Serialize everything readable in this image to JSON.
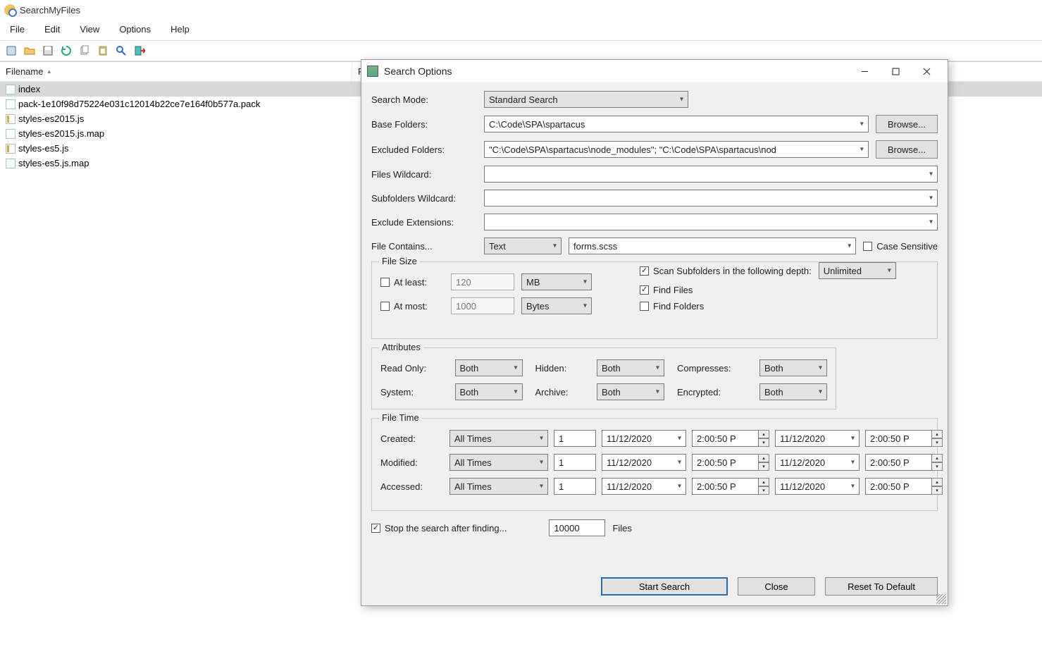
{
  "window": {
    "title": "SearchMyFiles"
  },
  "menu": {
    "file": "File",
    "edit": "Edit",
    "view": "View",
    "options": "Options",
    "help": "Help"
  },
  "columns": {
    "filename": "Filename",
    "col2": "F"
  },
  "files": [
    {
      "name": "index",
      "icon": "doc",
      "selected": true
    },
    {
      "name": "pack-1e10f98d75224e031c12014b22ce7e164f0b577a.pack",
      "icon": "doc"
    },
    {
      "name": "styles-es2015.js",
      "icon": "js"
    },
    {
      "name": "styles-es2015.js.map",
      "icon": "doc"
    },
    {
      "name": "styles-es5.js",
      "icon": "js"
    },
    {
      "name": "styles-es5.js.map",
      "icon": "doc"
    }
  ],
  "dlg": {
    "title": "Search Options",
    "labels": {
      "searchMode": "Search Mode:",
      "baseFolders": "Base Folders:",
      "excludedFolders": "Excluded Folders:",
      "filesWildcard": "Files Wildcard:",
      "subfoldersWildcard": "Subfolders Wildcard:",
      "excludeExt": "Exclude Extensions:",
      "fileContains": "File Contains...",
      "caseSensitive": "Case Sensitive",
      "browse": "Browse...",
      "fileSize": "File Size",
      "atLeast": "At least:",
      "atMost": "At most:",
      "scanSub": "Scan Subfolders in the following depth:",
      "findFiles": "Find Files",
      "findFolders": "Find Folders",
      "attributes": "Attributes",
      "readOnly": "Read Only:",
      "hidden": "Hidden:",
      "compresses": "Compresses:",
      "system": "System:",
      "archive": "Archive:",
      "encrypted": "Encrypted:",
      "fileTime": "File Time",
      "created": "Created:",
      "modified": "Modified:",
      "accessed": "Accessed:",
      "stopAfter": "Stop the search after finding...",
      "filesWord": "Files",
      "start": "Start Search",
      "close": "Close",
      "reset": "Reset To Default"
    },
    "vals": {
      "searchMode": "Standard Search",
      "baseFolders": "C:\\Code\\SPA\\spartacus",
      "excludedFolders": "\"C:\\Code\\SPA\\spartacus\\node_modules\"; \"C:\\Code\\SPA\\spartacus\\nod",
      "filesWildcard": "",
      "subfoldersWildcard": "",
      "excludeExt": "",
      "containsType": "Text",
      "containsValue": "forms.scss",
      "atLeastVal": "120",
      "atLeastUnit": "MB",
      "atMostVal": "1000",
      "atMostUnit": "Bytes",
      "depth": "Unlimited",
      "attrBoth": "Both",
      "timeMode": "All Times",
      "timeCount": "1",
      "date": "11/12/2020",
      "time": "2:00:50 P",
      "stopCount": "10000"
    },
    "checks": {
      "atLeast": false,
      "atMost": false,
      "scanSub": true,
      "findFiles": true,
      "findFolders": false,
      "caseSensitive": false,
      "stopAfter": true
    }
  }
}
